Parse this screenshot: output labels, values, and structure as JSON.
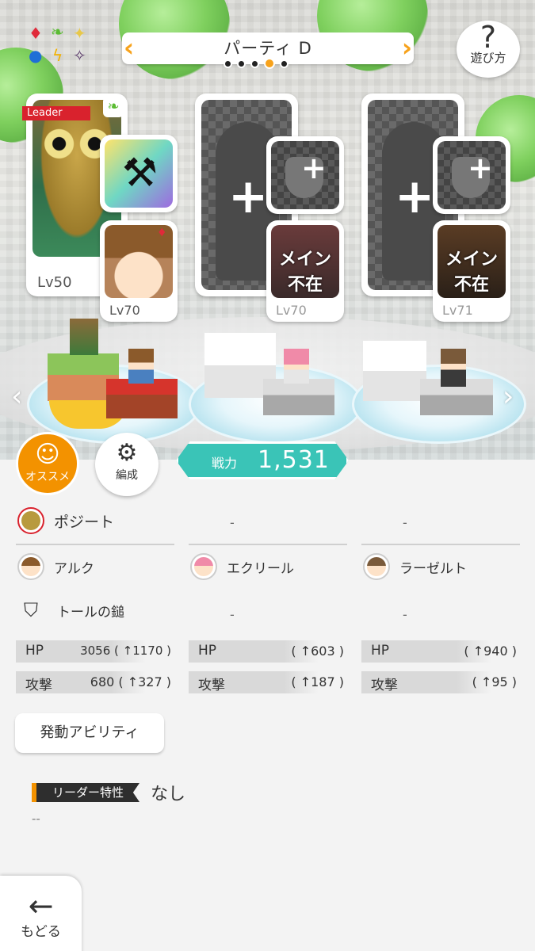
{
  "header": {
    "party_name": "パーティ D",
    "page_indicator": {
      "count": 5,
      "active_index": 3
    },
    "help_label": "遊び方",
    "prev_arrow": "‹",
    "next_arrow": "›"
  },
  "element_icons": [
    "♦",
    "❧",
    "✦",
    "●",
    "ϟ",
    "✧"
  ],
  "slots": [
    {
      "leader_tag": "Leader",
      "main_level": "Lv50",
      "sub_level": "Lv70",
      "weapon": "hammer"
    },
    {
      "main_plus": "+",
      "sub_label_line1": "メイン",
      "sub_label_line2": "不在",
      "sub_level": "Lv70"
    },
    {
      "main_plus": "+",
      "sub_label_line1": "メイン",
      "sub_label_line2": "不在",
      "sub_level": "Lv71"
    }
  ],
  "controls": {
    "recommend_label": "オススメ",
    "formation_label": "編成",
    "power_label": "戦力",
    "power_value": "1,531"
  },
  "details": {
    "main_names": [
      "ポジート",
      "-",
      "-"
    ],
    "sub_names": [
      "アルク",
      "エクリール",
      "ラーゼルト"
    ],
    "weapons": [
      "トールの鎚",
      "-",
      "-"
    ],
    "stats": [
      {
        "hp_label": "HP",
        "hp_value": "3056 ( ↑1170 )",
        "atk_label": "攻撃",
        "atk_value": "680 ( ↑327 )"
      },
      {
        "hp_label": "HP",
        "hp_value": "( ↑603 )",
        "atk_label": "攻撃",
        "atk_value": "( ↑187 )"
      },
      {
        "hp_label": "HP",
        "hp_value": "( ↑940 )",
        "atk_label": "攻撃",
        "atk_value": "( ↑95 )"
      }
    ]
  },
  "ability_button": "発動アビリティ",
  "leader_trait": {
    "label": "リーダー特性",
    "value": "なし",
    "description": "--"
  },
  "back": {
    "arrow": "←",
    "label": "もどる"
  },
  "colors": {
    "accent": "#f39200",
    "power": "#3ac4b7",
    "leader_red": "#d9222d"
  }
}
